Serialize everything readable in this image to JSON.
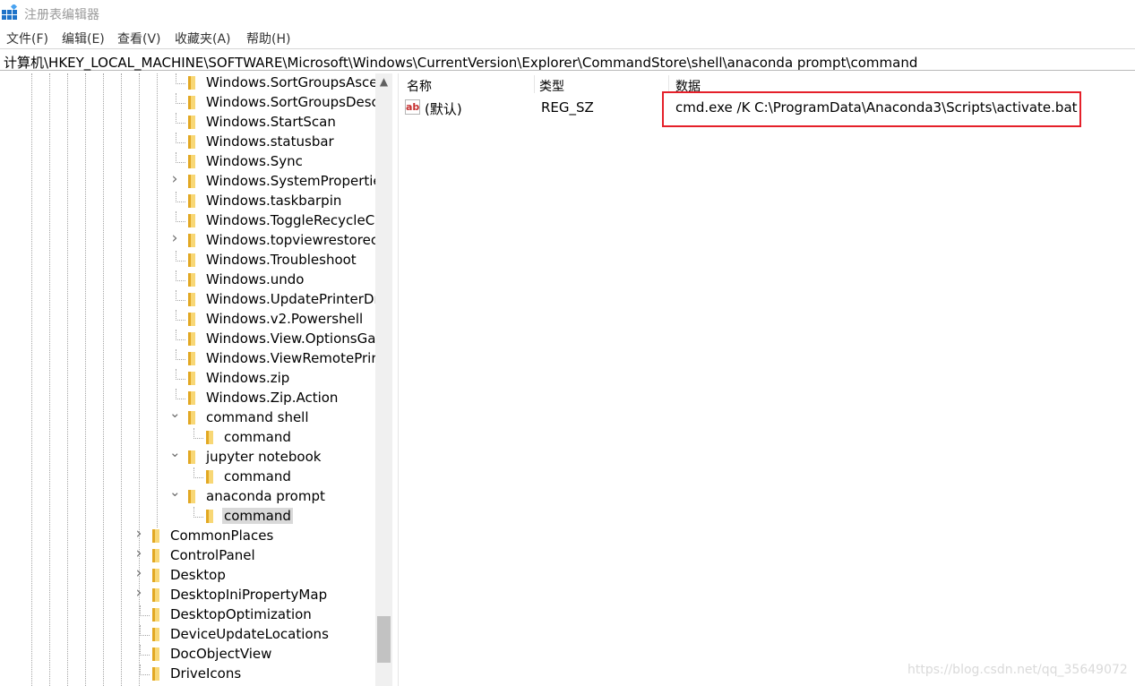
{
  "window": {
    "title": "注册表编辑器"
  },
  "menu": [
    "文件(F)",
    "编辑(E)",
    "查看(V)",
    "收藏夹(A)",
    "帮助(H)"
  ],
  "address": "计算机\\HKEY_LOCAL_MACHINE\\SOFTWARE\\Microsoft\\Windows\\CurrentVersion\\Explorer\\CommandStore\\shell\\anaconda prompt\\command",
  "tree": [
    {
      "label": "Windows.SortGroupsAsce",
      "level": 2,
      "chevron": ""
    },
    {
      "label": "Windows.SortGroupsDesc",
      "level": 2,
      "chevron": ""
    },
    {
      "label": "Windows.StartScan",
      "level": 2,
      "chevron": ""
    },
    {
      "label": "Windows.statusbar",
      "level": 2,
      "chevron": ""
    },
    {
      "label": "Windows.Sync",
      "level": 2,
      "chevron": ""
    },
    {
      "label": "Windows.SystemPropertie",
      "level": 2,
      "chevron": "collapsed"
    },
    {
      "label": "Windows.taskbarpin",
      "level": 2,
      "chevron": ""
    },
    {
      "label": "Windows.ToggleRecycleC",
      "level": 2,
      "chevron": ""
    },
    {
      "label": "Windows.topviewrestorec",
      "level": 2,
      "chevron": "collapsed"
    },
    {
      "label": "Windows.Troubleshoot",
      "level": 2,
      "chevron": ""
    },
    {
      "label": "Windows.undo",
      "level": 2,
      "chevron": ""
    },
    {
      "label": "Windows.UpdatePrinterDr",
      "level": 2,
      "chevron": ""
    },
    {
      "label": "Windows.v2.Powershell",
      "level": 2,
      "chevron": ""
    },
    {
      "label": "Windows.View.OptionsGa",
      "level": 2,
      "chevron": ""
    },
    {
      "label": "Windows.ViewRemotePrir",
      "level": 2,
      "chevron": ""
    },
    {
      "label": "Windows.zip",
      "level": 2,
      "chevron": ""
    },
    {
      "label": "Windows.Zip.Action",
      "level": 2,
      "chevron": ""
    },
    {
      "label": "command shell",
      "level": 2,
      "chevron": "expanded"
    },
    {
      "label": "command",
      "level": 3,
      "chevron": ""
    },
    {
      "label": "jupyter notebook",
      "level": 2,
      "chevron": "expanded"
    },
    {
      "label": "command",
      "level": 3,
      "chevron": ""
    },
    {
      "label": "anaconda prompt",
      "level": 2,
      "chevron": "expanded"
    },
    {
      "label": "command",
      "level": 3,
      "chevron": "",
      "selected": true
    },
    {
      "label": "CommonPlaces",
      "level": 1,
      "chevron": "collapsed"
    },
    {
      "label": "ControlPanel",
      "level": 1,
      "chevron": "collapsed"
    },
    {
      "label": "Desktop",
      "level": 1,
      "chevron": "collapsed"
    },
    {
      "label": "DesktopIniPropertyMap",
      "level": 1,
      "chevron": "collapsed"
    },
    {
      "label": "DesktopOptimization",
      "level": 1,
      "chevron": ""
    },
    {
      "label": "DeviceUpdateLocations",
      "level": 1,
      "chevron": ""
    },
    {
      "label": "DocObjectView",
      "level": 1,
      "chevron": ""
    },
    {
      "label": "DriveIcons",
      "level": 1,
      "chevron": ""
    }
  ],
  "columns": {
    "name": "名称",
    "type": "类型",
    "data": "数据"
  },
  "values": [
    {
      "icon": "ab",
      "name": "(默认)",
      "type": "REG_SZ",
      "data": "cmd.exe /K  C:\\ProgramData\\Anaconda3\\Scripts\\activate.bat"
    }
  ],
  "watermark": "https://blog.csdn.net/qq_35649072",
  "colors": {
    "highlight_border": "#e5202a",
    "folder": "#f8d775",
    "selection": "#d9d9d9"
  },
  "icons": {
    "app": "registry-editor-icon",
    "folder": "folder-icon",
    "string_value": "string-value-icon",
    "expand": "chevron-right-icon",
    "collapse": "chevron-down-icon"
  }
}
